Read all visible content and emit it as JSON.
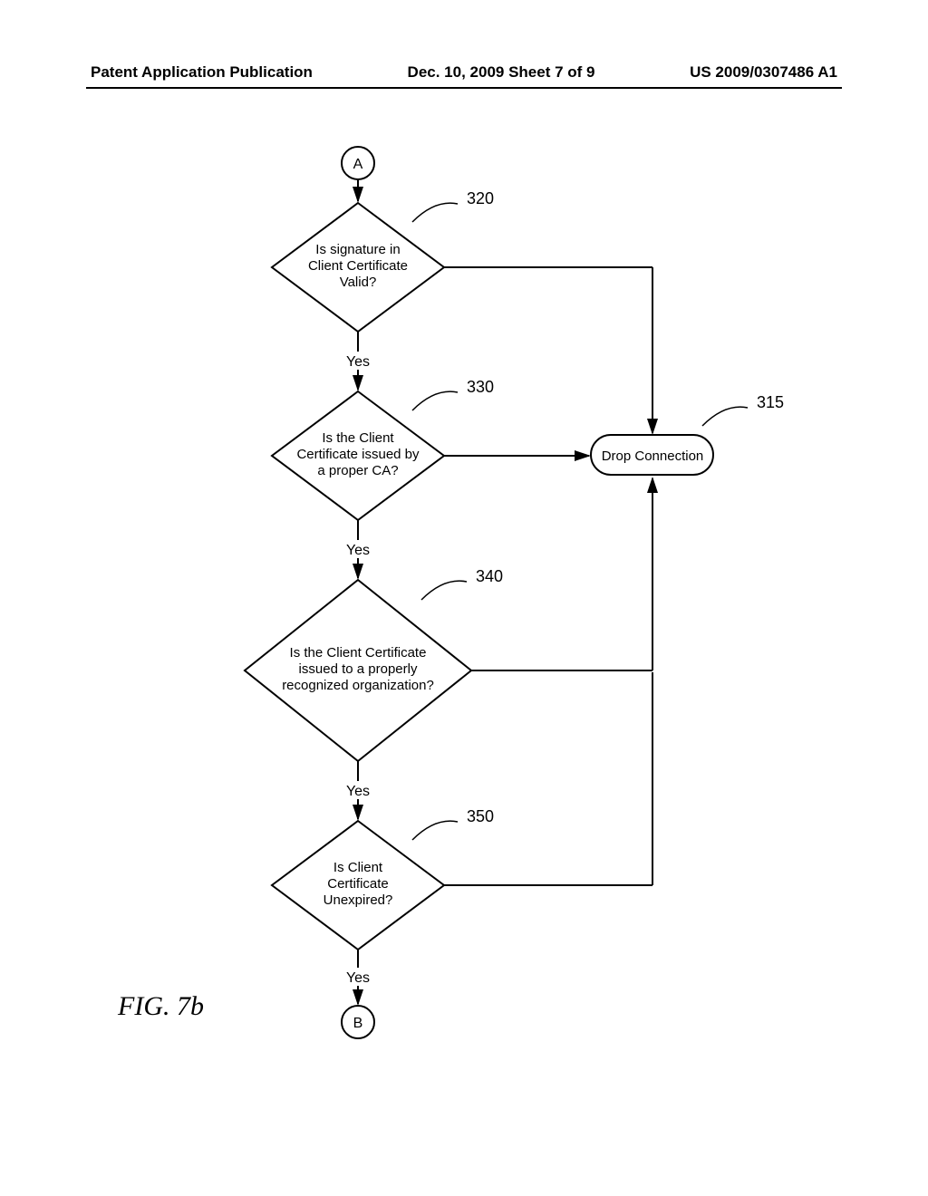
{
  "header": {
    "left": "Patent Application Publication",
    "middle": "Dec. 10, 2009  Sheet 7 of 9",
    "right": "US 2009/0307486 A1"
  },
  "connectors": {
    "top": "A",
    "bottom": "B"
  },
  "decisions": {
    "d1": {
      "ref": "320",
      "line1": "Is signature in",
      "line2": "Client Certificate",
      "line3": "Valid?"
    },
    "d2": {
      "ref": "330",
      "line1": "Is the Client",
      "line2": "Certificate issued by",
      "line3": "a proper CA?"
    },
    "d3": {
      "ref": "340",
      "line1": "Is the Client Certificate",
      "line2": "issued to a properly",
      "line3": "recognized organization?"
    },
    "d4": {
      "ref": "350",
      "line1": "Is Client",
      "line2": "Certificate",
      "line3": "Unexpired?"
    }
  },
  "terminal": {
    "ref": "315",
    "label": "Drop Connection"
  },
  "edges": {
    "yes": "Yes"
  },
  "figure_label": "FIG. 7b"
}
